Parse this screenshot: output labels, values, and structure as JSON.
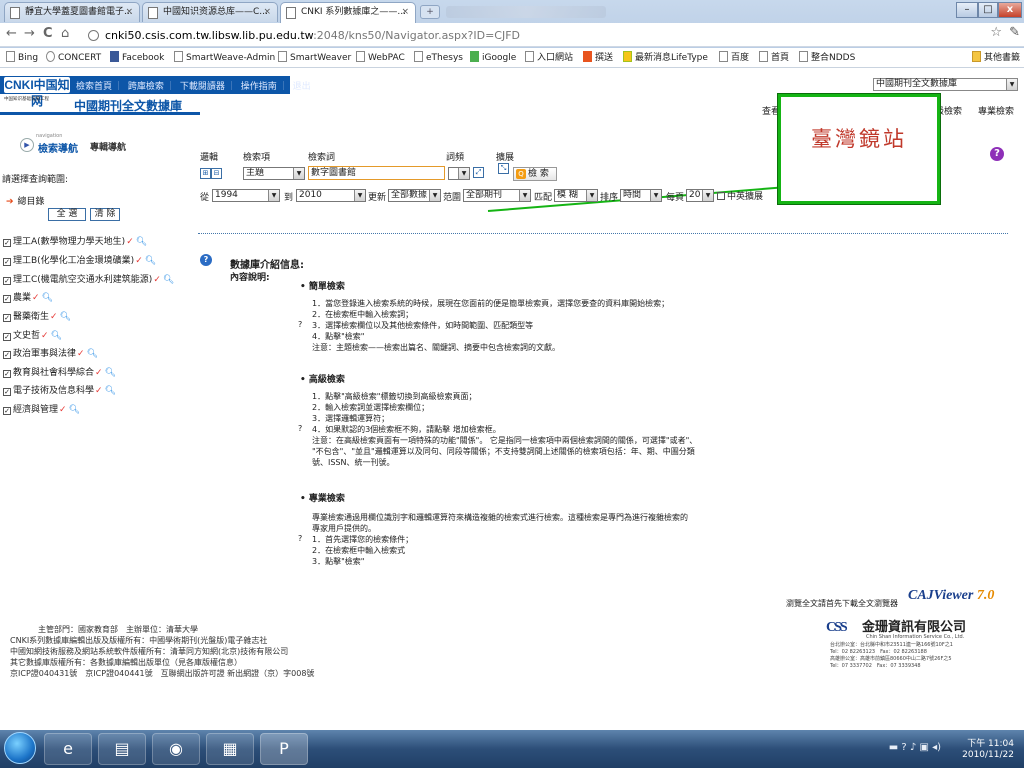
{
  "browser": {
    "tabs": [
      {
        "label": "靜宜大學蓋夏圖書館電子..."
      },
      {
        "label": "中國知识资源总库——C..."
      },
      {
        "label": "CNKI 系列數據庫之——..."
      }
    ],
    "url_host": "cnki50.csis.com.tw.libsw.lib.pu.edu.tw",
    "url_rest": ":2048/kns50/Navigator.aspx?ID=CJFD",
    "bookmarks": [
      "Bing",
      "CONCERT",
      "Facebook",
      "SmartWeave-Admin",
      "SmartWeaver",
      "WebPAC",
      "eThesys",
      "iGoogle",
      "入口網站",
      "撰送",
      "最新消息LifeType",
      "百度",
      "首頁",
      "整合NDDS"
    ],
    "other_bookmarks": "其他書籤"
  },
  "header": {
    "logo_text": "CNKI中国知网",
    "logo_sub": "中国知识基础设施工程",
    "nav": [
      "檢索首頁",
      "跨庫檢索",
      "下載閱讀器",
      "操作指南",
      "退出"
    ],
    "db_title": "中國期刊全文數據庫",
    "db_selector": "中國期刊全文數據庫",
    "tab_query": "查看",
    "tab_advanced": "級檢索",
    "tab_pro": "專業檢索"
  },
  "callout": {
    "label": "臺灣鏡站"
  },
  "sidebar": {
    "nav_small": "navigation",
    "nav_search": "檢索導航",
    "nav_pro": "專輯導航",
    "scope_label": "請選擇查詢範圍:",
    "total": "總目錄",
    "btn_all": "全 選",
    "btn_clear": "清 除",
    "categories": [
      "理工A(數學物理力學天地生)",
      "理工B(化學化工冶金環境礦業)",
      "理工C(機電航空交通水利建筑能源)",
      "農業",
      "醫藥衛生",
      "文史哲",
      "政治軍事與法律",
      "教育與社會科學綜合",
      "電子技術及信息科學",
      "經濟與管理"
    ]
  },
  "form": {
    "col_logic": "邏輯",
    "col_field": "檢索項",
    "col_keyword": "檢索詞",
    "col_freq": "詞頻",
    "col_extend": "擴展",
    "field_value": "主題",
    "keyword_value": "數字圖書館",
    "search_btn": "檢 索",
    "from_label": "從",
    "from_year": "1994",
    "to_label": "到",
    "to_year": "2010",
    "update_label": "更新",
    "update_value": "全部數據",
    "range_label": "范圍",
    "range_value": "全部期刊",
    "match_label": "匹配",
    "match_value": "模 糊",
    "sort_label": "排序",
    "sort_value": "時間",
    "per_page_label": "每頁",
    "per_page_value": "20",
    "zh_en": "中英擴展"
  },
  "info": {
    "title": "數據庫介紹信息:",
    "content_label": "內容說明:",
    "simple": {
      "heading": "簡單檢索",
      "lines": [
        "1．當您登錄進入檢索系統的時候，展現在您面前的便是簡單檢索頁，選擇您要查的資料庫開始檢索；",
        "2．在檢索框中輸入檢索詞；",
        "3．選擇檢索欄位以及其他檢索條件，如時間範圍、匹配類型等",
        "4．點擊\"檢索\"",
        "注意：主題檢索——檢索出篇名、關鍵詞、摘要中包含檢索詞的文獻。"
      ]
    },
    "advanced": {
      "heading": "高級檢索",
      "lines": [
        "1．點擊\"高級檢索\"標籤切換到高級檢索頁面；",
        "2．輸入檢索詞並選擇檢索欄位；",
        "3．選擇邏輯運算符；",
        "4．如果默認的3個檢索框不夠，請點擊 增加檢索框。",
        "注意：在高級檢索頁面有一項特殊的功能\"關係\"。 它是指同一檢索項中兩個檢索詞間的關係，可選擇\"或者\"、",
        "\"不包含\"、\"並且\"邏輯運算以及同句、同段等關係；不支持雙詞間上述關係的檢索項包括：年、期、中圖分類",
        "號、ISSN、統一刊號。"
      ]
    },
    "professional": {
      "heading": "專業檢索",
      "lines": [
        "專業檢索通過用欄位識別字和邏輯運算符來構造複雜的檢索式進行檢索。這種檢索是專門為進行複雜檢索的",
        "專家用戶提供的。",
        "1．首先選擇您的檢索條件；",
        "2．在檢索框中輸入檢索式",
        "3．點擊\"檢索\""
      ]
    }
  },
  "cajviewer": {
    "note": "瀏覽全文請首先下載全文瀏覽器",
    "name": "CAJViewer",
    "version": "7.0"
  },
  "footer": {
    "lines": [
      "主管部門：國家教育部　主辦單位：清華大學",
      "CNKI系列數據庫編輯出版及版權所有：中國學術期刊(光盤版)電子雜志社",
      "中國知網技術服務及網站系統軟件版權所有：清華同方知網(北京)技術有限公司",
      "其它數據庫版權所有：各數據庫編輯出版單位（見各庫版權信息）",
      "京ICP證040431號　京ICP證040441號　互聯網出版許可證 新出網證（京）字008號"
    ]
  },
  "corp": {
    "mark": "CSS",
    "name": "金珊資訊有限公司",
    "name_en": "Chin Shan Information Service Co., Ltd.",
    "lines": [
      "台北辦公室：台北縣中和市23511連一路166號10F之1",
      "Tel：02 82263123　Fax：02 82263188",
      "高雄辦公室：高雄市前鎮區80660中山二路7號26F之5",
      "Tel：07 3337702　Fax：07 3339348"
    ]
  },
  "taskbar": {
    "time": "下午 11:04",
    "date": "2010/11/22"
  },
  "colors": {
    "brand_blue": "#0d56a8",
    "callout_green": "#15b414",
    "callout_text": "#c0392b"
  }
}
